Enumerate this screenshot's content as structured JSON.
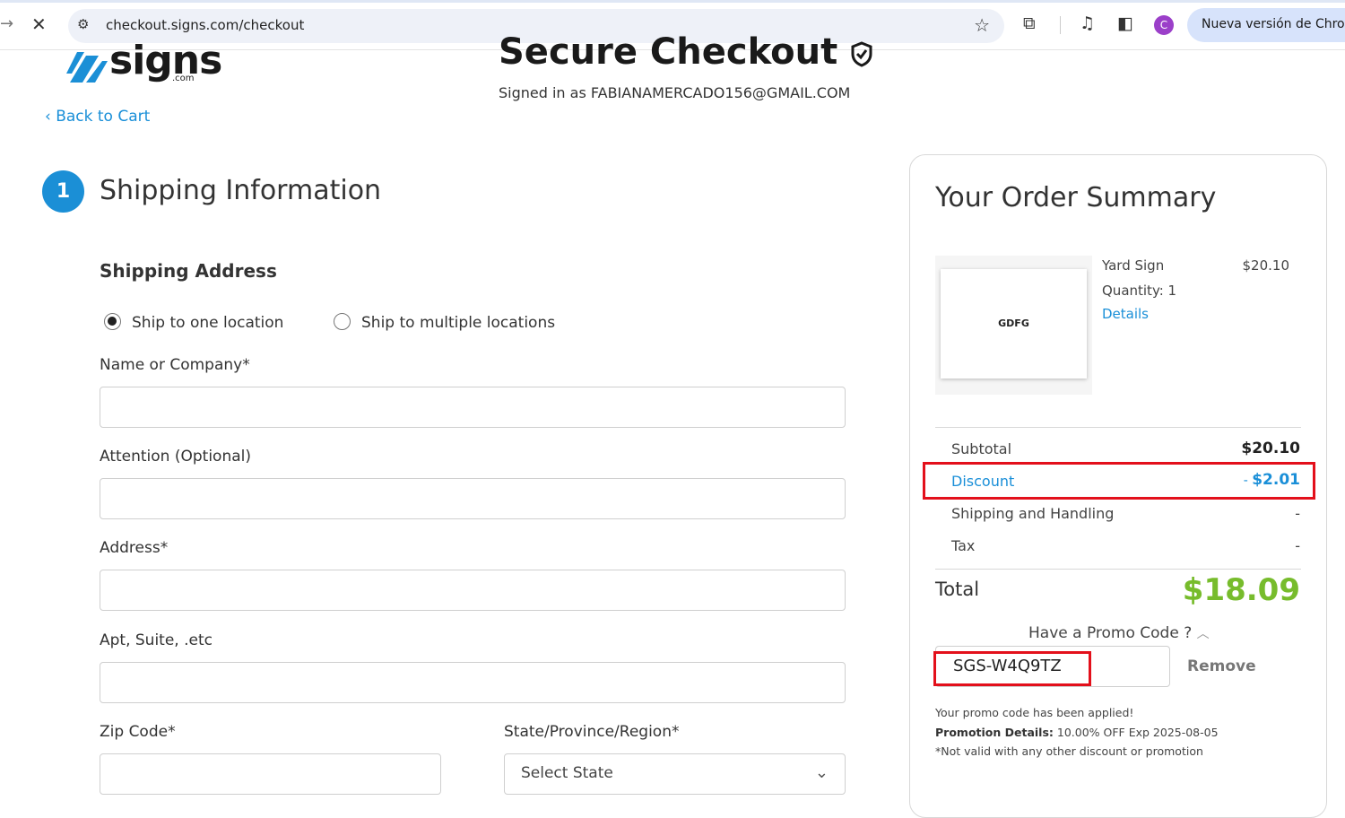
{
  "browser": {
    "url": "checkout.signs.com/checkout",
    "update_label": "Nueva versión de Chrome",
    "profile_initial": "C"
  },
  "page": {
    "logo_text": "signs",
    "logo_suffix": ".com",
    "title": "Secure Checkout",
    "signed_in": "Signed in as FABIANAMERCADO156@GMAIL.COM",
    "back_link": "Back to Cart"
  },
  "shipping": {
    "step_number": "1",
    "step_title": "Shipping Information",
    "section_title": "Shipping Address",
    "options": [
      {
        "label": "Ship to one location",
        "selected": true
      },
      {
        "label": "Ship to multiple locations",
        "selected": false
      }
    ],
    "fields": {
      "name": {
        "label": "Name or Company*",
        "value": ""
      },
      "attention": {
        "label": "Attention (Optional)",
        "value": ""
      },
      "address": {
        "label": "Address*",
        "value": ""
      },
      "apt": {
        "label": "Apt, Suite, .etc",
        "value": ""
      },
      "zip": {
        "label": "Zip Code*",
        "value": ""
      },
      "state": {
        "label": "State/Province/Region*",
        "value": "Select State"
      }
    }
  },
  "summary": {
    "title": "Your Order Summary",
    "item": {
      "name": "Yard Sign",
      "price": "$20.10",
      "quantity": "Quantity: 1",
      "details_link": "Details",
      "thumb_text": "GDFG"
    },
    "rows": {
      "subtotal": {
        "label": "Subtotal",
        "value": "$20.10"
      },
      "discount": {
        "label": "Discount",
        "value_prefix": "- ",
        "value": "$2.01"
      },
      "shipping": {
        "label": "Shipping and Handling",
        "value": "-"
      },
      "tax": {
        "label": "Tax",
        "value": "-"
      }
    },
    "total_label": "Total",
    "total_value": "$18.09",
    "promo_question": "Have a Promo Code ?",
    "promo_code": "SGS-W4Q9TZ",
    "remove_label": "Remove",
    "promo_applied": "Your promo code has been applied!",
    "promo_details_label": "Promotion Details:",
    "promo_details": " 10.00% OFF Exp 2025-08-05",
    "promo_note": "*Not valid with any other discount or promotion"
  },
  "colors": {
    "accent": "#1a8fd8",
    "total": "#77bc2c",
    "highlight": "#e3101b"
  }
}
